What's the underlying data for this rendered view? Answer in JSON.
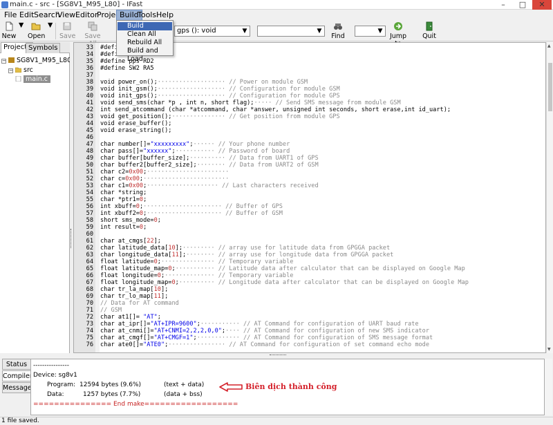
{
  "window": {
    "title": "main.c - src - [SG8V1_M95_L80] - IFast",
    "minimize": "–",
    "maximize": "□",
    "close": "✕"
  },
  "menu": {
    "items": [
      "File",
      "Edit",
      "Search",
      "View",
      "Editor",
      "Project",
      "Build",
      "Tools",
      "Help"
    ],
    "active": "Build"
  },
  "build_menu": {
    "items": [
      "Build",
      "Clean All",
      "Rebuild All",
      "Build and Load"
    ],
    "highlighted": "Build"
  },
  "toolbar": {
    "new_label": "New",
    "open_label": "Open",
    "save_label": "Save",
    "saveall_label": "Save All",
    "function_combo": "gps (): void",
    "find_label": "Find",
    "jumpto_label": "Jump to",
    "quit_label": "Quit"
  },
  "left_panel": {
    "tabs": [
      "Projects",
      "Symbols"
    ],
    "active_tab": "Projects",
    "tree": {
      "project": "SG8V1_M95_L80",
      "folder": "src",
      "file": "main.c"
    }
  },
  "editor": {
    "lines": [
      {
        "n": "33",
        "t": [
          [
            "#defi",
            "kw"
          ]
        ]
      },
      {
        "n": "34",
        "t": [
          [
            "#defi",
            "kw"
          ]
        ]
      },
      {
        "n": "35",
        "t": [
          [
            "#define pps RD2",
            "kw"
          ]
        ]
      },
      {
        "n": "36",
        "t": [
          [
            "#define SW2 RA5",
            "kw"
          ]
        ]
      },
      {
        "n": "37",
        "t": []
      },
      {
        "n": "38",
        "t": [
          [
            "void power_on();",
            "kw"
          ],
          [
            "··················· // Power on module GSM",
            "cm"
          ]
        ]
      },
      {
        "n": "39",
        "t": [
          [
            "void init_gsm();",
            "kw"
          ],
          [
            "··················· // Configuration for module GSM",
            "cm"
          ]
        ]
      },
      {
        "n": "40",
        "t": [
          [
            "void init_gps();",
            "kw"
          ],
          [
            "··················· // Configuration for module GPS",
            "cm"
          ]
        ]
      },
      {
        "n": "41",
        "t": [
          [
            "void send_sms(char *p , int n, short flag);",
            "kw"
          ],
          [
            "····· // Send SMS message from module GSM",
            "cm"
          ]
        ]
      },
      {
        "n": "42",
        "t": [
          [
            "int send_atcommand (char *atcommand, char *answer, unsigned int seconds, short erase,int id_uart);",
            "kw"
          ]
        ]
      },
      {
        "n": "43",
        "t": [
          [
            "void get_position();",
            "kw"
          ],
          [
            "··············· // Get position from module GPS",
            "cm"
          ]
        ]
      },
      {
        "n": "44",
        "t": [
          [
            "void erase_buffer();",
            "kw"
          ]
        ]
      },
      {
        "n": "45",
        "t": [
          [
            "void erase_string();",
            "kw"
          ]
        ]
      },
      {
        "n": "46",
        "t": []
      },
      {
        "n": "47",
        "t": [
          [
            "char number[]=",
            "kw"
          ],
          [
            "\"xxxxxxxxx\"",
            "st"
          ],
          [
            ";",
            "kw"
          ],
          [
            "······ // Your phone number",
            "cm"
          ]
        ]
      },
      {
        "n": "48",
        "t": [
          [
            "char pass[]=",
            "kw"
          ],
          [
            "\"xxxxxx\"",
            "st"
          ],
          [
            ";",
            "kw"
          ],
          [
            "··········· // Password of board",
            "cm"
          ]
        ]
      },
      {
        "n": "49",
        "t": [
          [
            "char buffer[buffer_size];",
            "kw"
          ],
          [
            "·········· // Data from UART1 of GPS",
            "cm"
          ]
        ]
      },
      {
        "n": "50",
        "t": [
          [
            "char buffer2[buffer2_size];",
            "kw"
          ],
          [
            "········ // Data from UART2 of GSM",
            "cm"
          ]
        ]
      },
      {
        "n": "51",
        "t": [
          [
            "char c2=",
            "kw"
          ],
          [
            "0x00",
            "nm"
          ],
          [
            ";",
            "kw"
          ],
          [
            "·······················",
            "cm"
          ]
        ]
      },
      {
        "n": "52",
        "t": [
          [
            "char c=",
            "kw"
          ],
          [
            "0x00",
            "nm"
          ],
          [
            ";",
            "kw"
          ],
          [
            "························",
            "cm"
          ]
        ]
      },
      {
        "n": "53",
        "t": [
          [
            "char c1=",
            "kw"
          ],
          [
            "0x00",
            "nm"
          ],
          [
            ";",
            "kw"
          ],
          [
            "···················· // Last characters received",
            "cm"
          ]
        ]
      },
      {
        "n": "54",
        "t": [
          [
            "char *string;",
            "kw"
          ]
        ]
      },
      {
        "n": "55",
        "t": [
          [
            "char *ptr1=",
            "kw"
          ],
          [
            "0",
            "nm"
          ],
          [
            ";",
            "kw"
          ]
        ]
      },
      {
        "n": "56",
        "t": [
          [
            "int xbuff=",
            "kw"
          ],
          [
            "0",
            "nm"
          ],
          [
            ";",
            "kw"
          ],
          [
            "······················ // Buffer of GPS",
            "cm"
          ]
        ]
      },
      {
        "n": "57",
        "t": [
          [
            "int xbuff2=",
            "kw"
          ],
          [
            "0",
            "nm"
          ],
          [
            ";",
            "kw"
          ],
          [
            "····················· // Buffer of GSM",
            "cm"
          ]
        ]
      },
      {
        "n": "58",
        "t": [
          [
            "short sms_mode=",
            "kw"
          ],
          [
            "0",
            "nm"
          ],
          [
            ";",
            "kw"
          ]
        ]
      },
      {
        "n": "59",
        "t": [
          [
            "int result=",
            "kw"
          ],
          [
            "0",
            "nm"
          ],
          [
            ";",
            "kw"
          ]
        ]
      },
      {
        "n": "60",
        "t": []
      },
      {
        "n": "61",
        "t": [
          [
            "char at_cmgs[",
            "kw"
          ],
          [
            "22",
            "nm"
          ],
          [
            "];",
            "kw"
          ]
        ]
      },
      {
        "n": "62",
        "t": [
          [
            "char latitude_data[",
            "kw"
          ],
          [
            "10",
            "nm"
          ],
          [
            "];",
            "kw"
          ],
          [
            "········· // array use for latitude data from GPGGA packet",
            "cm"
          ]
        ]
      },
      {
        "n": "63",
        "t": [
          [
            "char longitude_data[",
            "kw"
          ],
          [
            "11",
            "nm"
          ],
          [
            "];",
            "kw"
          ],
          [
            "········ // array use for longitude data from GPGGA packet",
            "cm"
          ]
        ]
      },
      {
        "n": "64",
        "t": [
          [
            "float latitude=",
            "kw"
          ],
          [
            "0",
            "nm"
          ],
          [
            ";",
            "kw"
          ],
          [
            "··············· // Temporary variable",
            "cm"
          ]
        ]
      },
      {
        "n": "65",
        "t": [
          [
            "float latitude_map=",
            "kw"
          ],
          [
            "0",
            "nm"
          ],
          [
            ";",
            "kw"
          ],
          [
            "··········· // Latitude data after calculator that can be displayed on Google Map",
            "cm"
          ]
        ]
      },
      {
        "n": "66",
        "t": [
          [
            "float longitude=",
            "kw"
          ],
          [
            "0",
            "nm"
          ],
          [
            ";",
            "kw"
          ],
          [
            "·············· // Temporary variable",
            "cm"
          ]
        ]
      },
      {
        "n": "67",
        "t": [
          [
            "float longitude_map=",
            "kw"
          ],
          [
            "0",
            "nm"
          ],
          [
            ";",
            "kw"
          ],
          [
            "·········· // Longitude data after calculator that can be displayed on Google Map",
            "cm"
          ]
        ]
      },
      {
        "n": "68",
        "t": [
          [
            "char tr_la_map[",
            "kw"
          ],
          [
            "10",
            "nm"
          ],
          [
            "];",
            "kw"
          ]
        ]
      },
      {
        "n": "69",
        "t": [
          [
            "char tr_lo_map[",
            "kw"
          ],
          [
            "11",
            "nm"
          ],
          [
            "];",
            "kw"
          ]
        ]
      },
      {
        "n": "70",
        "t": [
          [
            "// Data for AT command",
            "cm"
          ]
        ]
      },
      {
        "n": "71",
        "t": [
          [
            "// GSM",
            "cm"
          ]
        ]
      },
      {
        "n": "72",
        "t": [
          [
            "char at1[]= ",
            "kw"
          ],
          [
            "\"AT\"",
            "st"
          ],
          [
            ";",
            "kw"
          ]
        ]
      },
      {
        "n": "73",
        "t": [
          [
            "char at_ipr[]=",
            "kw"
          ],
          [
            "\"AT+IPR=9600\"",
            "st"
          ],
          [
            ";",
            "kw"
          ],
          [
            "··········· // AT Command for configuration of UART baud rate",
            "cm"
          ]
        ]
      },
      {
        "n": "74",
        "t": [
          [
            "char at_cnmi[]=",
            "kw"
          ],
          [
            "\"AT+CNMI=2,2,2,0,0\"",
            "st"
          ],
          [
            ";",
            "kw"
          ],
          [
            "···· // AT Command for configuration of new SMS indicator",
            "cm"
          ]
        ]
      },
      {
        "n": "75",
        "t": [
          [
            "char at_cmgf[]=",
            "kw"
          ],
          [
            "\"AT+CMGF=1\"",
            "st"
          ],
          [
            ";",
            "kw"
          ],
          [
            "············ // AT Command for configuration of SMS message format",
            "cm"
          ]
        ]
      },
      {
        "n": "76",
        "t": [
          [
            "char ate0[]=",
            "kw"
          ],
          [
            "\"ATE0\"",
            "st"
          ],
          [
            ";",
            "kw"
          ],
          [
            "················ // AT Command for configuration of set command echo mode",
            "cm"
          ]
        ]
      }
    ]
  },
  "bottom_panel": {
    "tabs": [
      "Status",
      "Compiler",
      "Messages"
    ],
    "active_tab": "Compiler",
    "output": {
      "line1": "----------------",
      "device": "Device: sg8v1",
      "program_label": "Program:",
      "program_value": "12594 bytes (9.6%)",
      "program_note": "(text + data)",
      "data_label": "Data:",
      "data_value": "1257 bytes (7.7%)",
      "data_note": "(data + bss)",
      "end": "=============== End make=================="
    },
    "annotation": "Biên dịch thành công"
  },
  "statusbar": {
    "text": "1 file saved."
  },
  "colors": {
    "comment": "#8a8a8a",
    "string": "#0000e8",
    "number": "#c03030",
    "annotation": "#d4202a",
    "menu_highlight": "#3e68b4"
  }
}
